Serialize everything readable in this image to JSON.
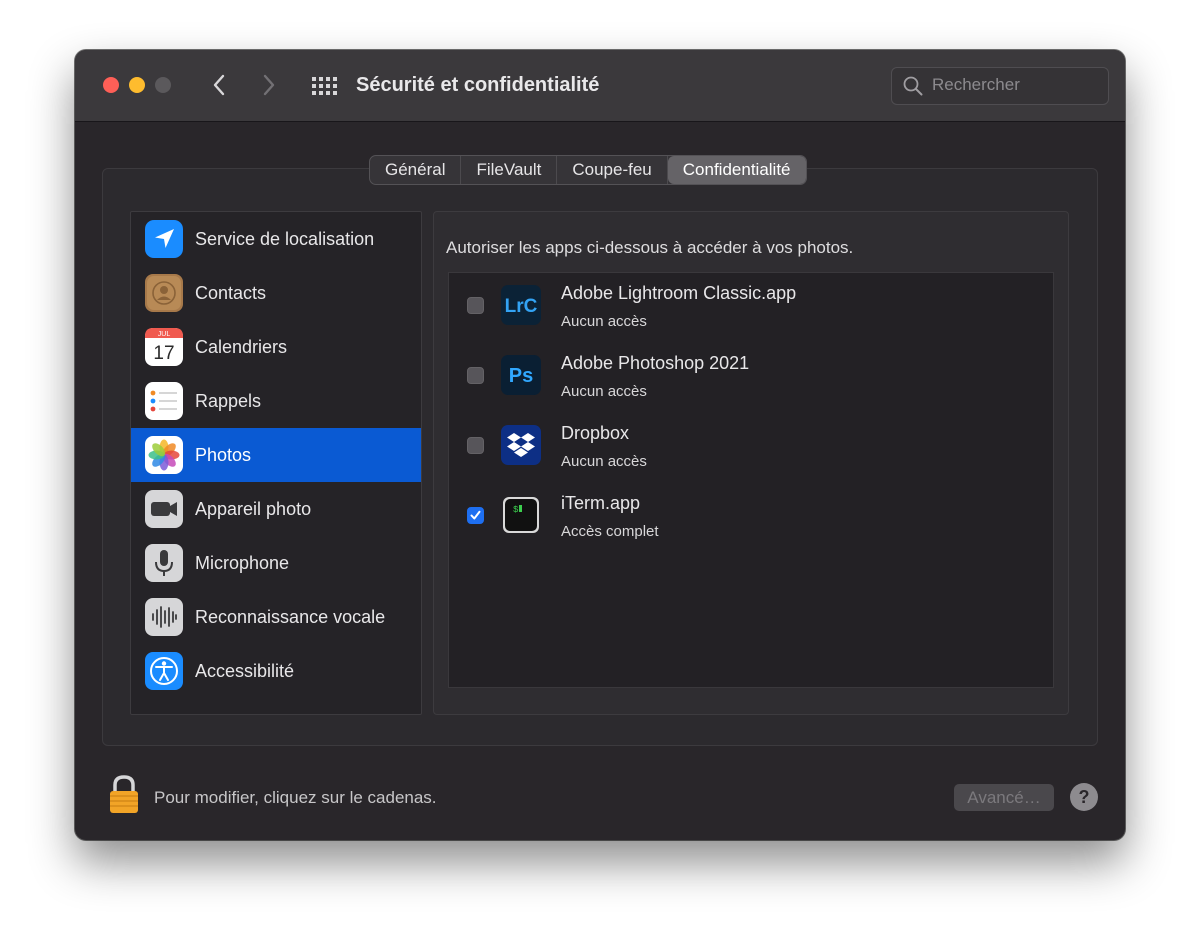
{
  "window": {
    "title": "Sécurité et confidentialité"
  },
  "search": {
    "placeholder": "Rechercher"
  },
  "tabs": [
    {
      "label": "Général"
    },
    {
      "label": "FileVault"
    },
    {
      "label": "Coupe-feu"
    },
    {
      "label": "Confidentialité",
      "active": true
    }
  ],
  "sidebar": {
    "items": [
      {
        "label": "Service de localisation",
        "icon": "location-icon"
      },
      {
        "label": "Contacts",
        "icon": "contacts-icon"
      },
      {
        "label": "Calendriers",
        "icon": "calendar-icon",
        "icon_month": "JUL",
        "icon_day": "17"
      },
      {
        "label": "Rappels",
        "icon": "reminders-icon"
      },
      {
        "label": "Photos",
        "icon": "photos-icon",
        "selected": true
      },
      {
        "label": "Appareil photo",
        "icon": "camera-icon"
      },
      {
        "label": "Microphone",
        "icon": "microphone-icon"
      },
      {
        "label": "Reconnaissance vocale",
        "icon": "speech-recognition-icon"
      },
      {
        "label": "Accessibilité",
        "icon": "accessibility-icon"
      }
    ]
  },
  "main": {
    "description": "Autoriser les apps ci-dessous à accéder à vos photos.",
    "apps": [
      {
        "name": "Adobe Lightroom Classic.app",
        "status": "Aucun accès",
        "checked": false,
        "icon": "lightroom-icon",
        "icon_text": "LrC"
      },
      {
        "name": "Adobe Photoshop 2021",
        "status": "Aucun accès",
        "checked": false,
        "icon": "photoshop-icon",
        "icon_text": "Ps"
      },
      {
        "name": "Dropbox",
        "status": "Aucun accès",
        "checked": false,
        "icon": "dropbox-icon"
      },
      {
        "name": "iTerm.app",
        "status": "Accès complet",
        "checked": true,
        "icon": "iterm-icon",
        "icon_text": "$"
      }
    ]
  },
  "footer": {
    "lock_text": "Pour modifier, cliquez sur le cadenas.",
    "advanced_label": "Avancé…",
    "help_label": "?"
  },
  "colors": {
    "selection": "#0a5ad3",
    "checkbox_checked": "#1e6ff1",
    "close": "#fe5f57",
    "minimize": "#febc2e"
  }
}
